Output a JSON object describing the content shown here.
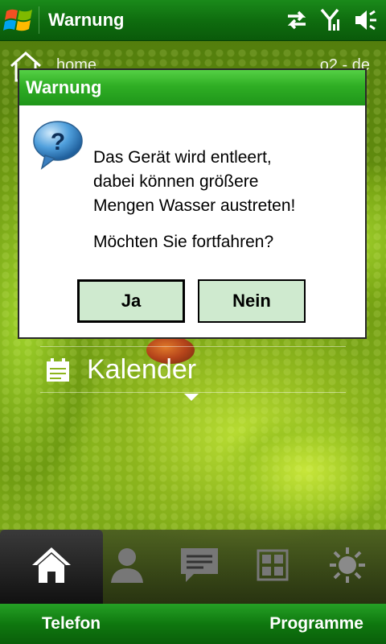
{
  "topbar": {
    "title": "Warnung",
    "icons": [
      "windows-start-icon",
      "sync-arrows-icon",
      "signal-strength-icon",
      "speaker-icon"
    ]
  },
  "home": {
    "label": "home",
    "carrier": "o2 - de"
  },
  "dialog": {
    "title": "Warnung",
    "icon": "question-bubble-icon",
    "message_lines": [
      "Das Gerät wird entleert,",
      "dabei können größere",
      "Mengen Wasser austreten!"
    ],
    "question": "Möchten Sie fortfahren?",
    "yes_label": "Ja",
    "no_label": "Nein"
  },
  "calendar": {
    "label": "Kalender"
  },
  "tabs": [
    "home-icon",
    "contacts-icon",
    "messages-icon",
    "apps-icon",
    "settings-icon"
  ],
  "softkeys": {
    "left": "Telefon",
    "right": "Programme"
  },
  "colors": {
    "accent_green": "#1f961a",
    "button_fill": "#cfeacf"
  }
}
